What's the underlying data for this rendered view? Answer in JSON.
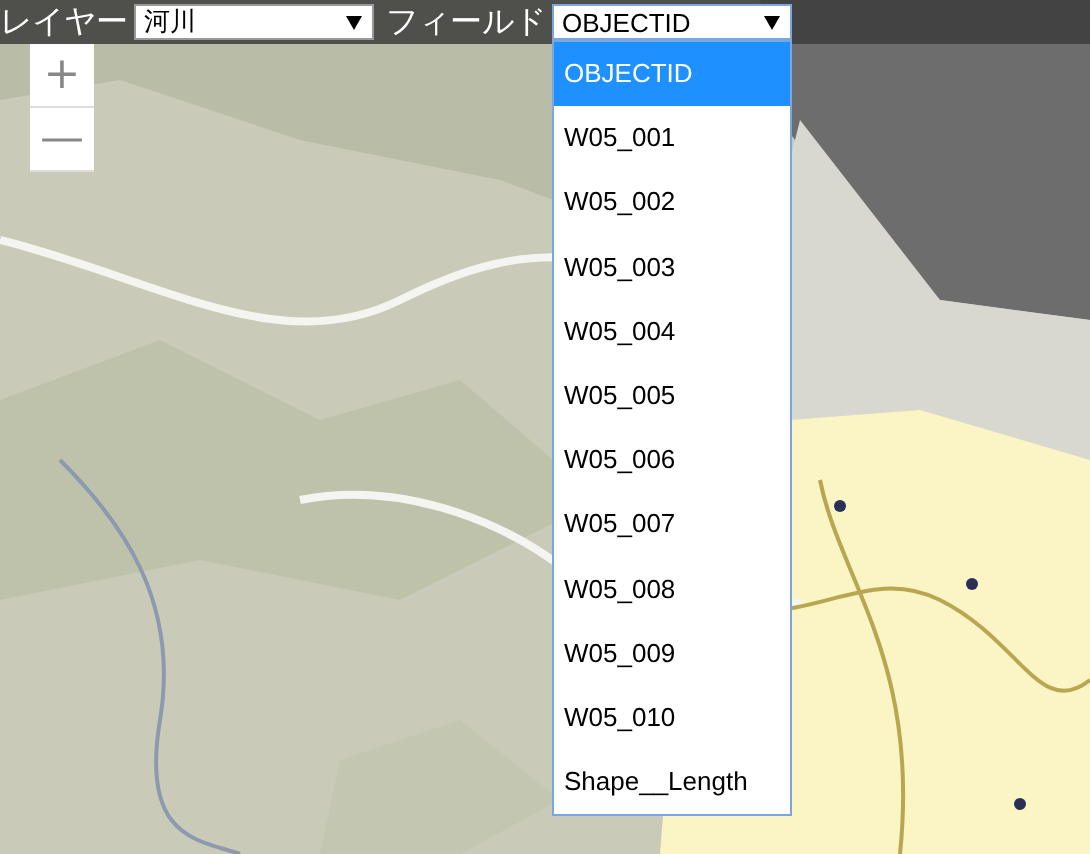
{
  "toolbar": {
    "layer_label": "レイヤー",
    "layer_select": {
      "value": "河川"
    },
    "field_label": "フィールド",
    "field_select": {
      "value": "OBJECTID",
      "expanded": true
    }
  },
  "field_options": [
    {
      "label": "OBJECTID",
      "selected": true
    },
    {
      "label": "W05_001",
      "selected": false
    },
    {
      "label": "W05_002",
      "selected": false
    },
    {
      "label": "W05_003",
      "selected": false
    },
    {
      "label": "W05_004",
      "selected": false
    },
    {
      "label": "W05_005",
      "selected": false
    },
    {
      "label": "W05_006",
      "selected": false
    },
    {
      "label": "W05_007",
      "selected": false
    },
    {
      "label": "W05_008",
      "selected": false
    },
    {
      "label": "W05_009",
      "selected": false
    },
    {
      "label": "W05_010",
      "selected": false
    },
    {
      "label": "Shape__Length",
      "selected": false
    }
  ],
  "zoom_controls": [
    "+",
    "—"
  ]
}
